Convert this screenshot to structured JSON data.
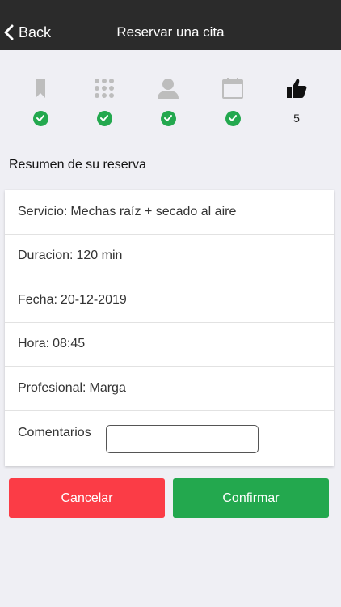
{
  "navbar": {
    "back_label": "Back",
    "title": "Reservar una cita"
  },
  "steps": [
    {
      "icon": "bookmark-icon",
      "status": "done"
    },
    {
      "icon": "grid-icon",
      "status": "done"
    },
    {
      "icon": "person-icon",
      "status": "done"
    },
    {
      "icon": "calendar-icon",
      "status": "done"
    },
    {
      "icon": "thumbs-up-icon",
      "status": "current",
      "number": "5"
    }
  ],
  "summary": {
    "title": "Resumen de su reserva",
    "servicio_label": "Servicio:",
    "servicio_value": "Mechas raíz + secado al aire",
    "duracion_label": "Duracion:",
    "duracion_value": "120 min",
    "fecha_label": "Fecha:",
    "fecha_value": "20-12-2019",
    "hora_label": "Hora:",
    "hora_value": "08:45",
    "profesional_label": "Profesional:",
    "profesional_value": "Marga",
    "comentarios_label": "Comentarios",
    "comentarios_value": ""
  },
  "actions": {
    "cancel_label": "Cancelar",
    "confirm_label": "Confirmar"
  },
  "colors": {
    "navbar_bg": "#2b2b2b",
    "success": "#23a84e",
    "danger": "#fb3c46",
    "inactive_icon": "#bdbdbd"
  }
}
